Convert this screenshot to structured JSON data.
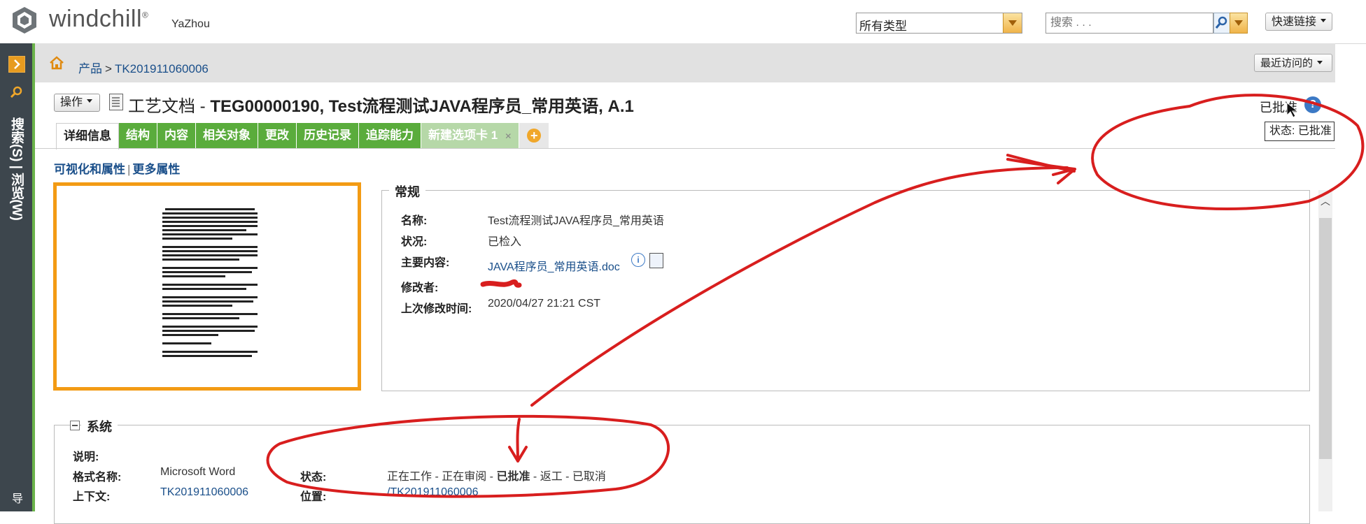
{
  "header": {
    "logo_text": "windchill",
    "logo_sup": "®",
    "user": "YaZhou",
    "type_select": "所有类型",
    "search_placeholder": "搜索 . . .",
    "quick_links": "快速链接"
  },
  "navigator": {
    "label": "搜索(S) | 浏览(W)",
    "bottom_label": "导"
  },
  "breadcrumb": {
    "root": "产品",
    "separator": ">",
    "current": "TK201911060006"
  },
  "recent": "最近访问的",
  "title": {
    "actions": "操作",
    "type": "工艺文档 - ",
    "number_name": "TEG00000190, Test流程测试JAVA程序员_常用英语, A.1",
    "status": "已批准",
    "tooltip": "状态: 已批准"
  },
  "tabs": [
    {
      "label": "详细信息"
    },
    {
      "label": "结构"
    },
    {
      "label": "内容"
    },
    {
      "label": "相关对象"
    },
    {
      "label": "更改"
    },
    {
      "label": "历史记录"
    },
    {
      "label": "追踪能力"
    },
    {
      "label": "新建选项卡 1"
    }
  ],
  "sublinks": {
    "visual": "可视化和属性",
    "separator": "|",
    "more": "更多属性"
  },
  "general": {
    "legend": "常规",
    "name_label": "名称:",
    "name_value": "Test流程测试JAVA程序员_常用英语",
    "state_label": "状况:",
    "state_value": "已检入",
    "content_label": "主要内容:",
    "content_value": "JAVA程序员_常用英语.doc",
    "modifier_label": "修改者:",
    "modified_label": "上次修改时间:",
    "modified_value": "2020/04/27 21:21 CST"
  },
  "system": {
    "legend": "系统",
    "desc_label": "说明:",
    "format_label": "格式名称:",
    "format_value": "Microsoft Word",
    "context_label": "上下文:",
    "context_value": "TK201911060006",
    "status_label": "状态:",
    "status_before": "正在工作 - 正在审阅 - ",
    "status_current": "已批准",
    "status_after": " - 返工 - 已取消",
    "location_label": "位置:",
    "location_value": "/TK201911060006"
  },
  "colors": {
    "green_tab": "#5aac3c",
    "nav_dark": "#3d464d",
    "accent_orange": "#f39b14",
    "link_blue": "#1a4f8a",
    "annotation_red": "#d81e1e"
  }
}
